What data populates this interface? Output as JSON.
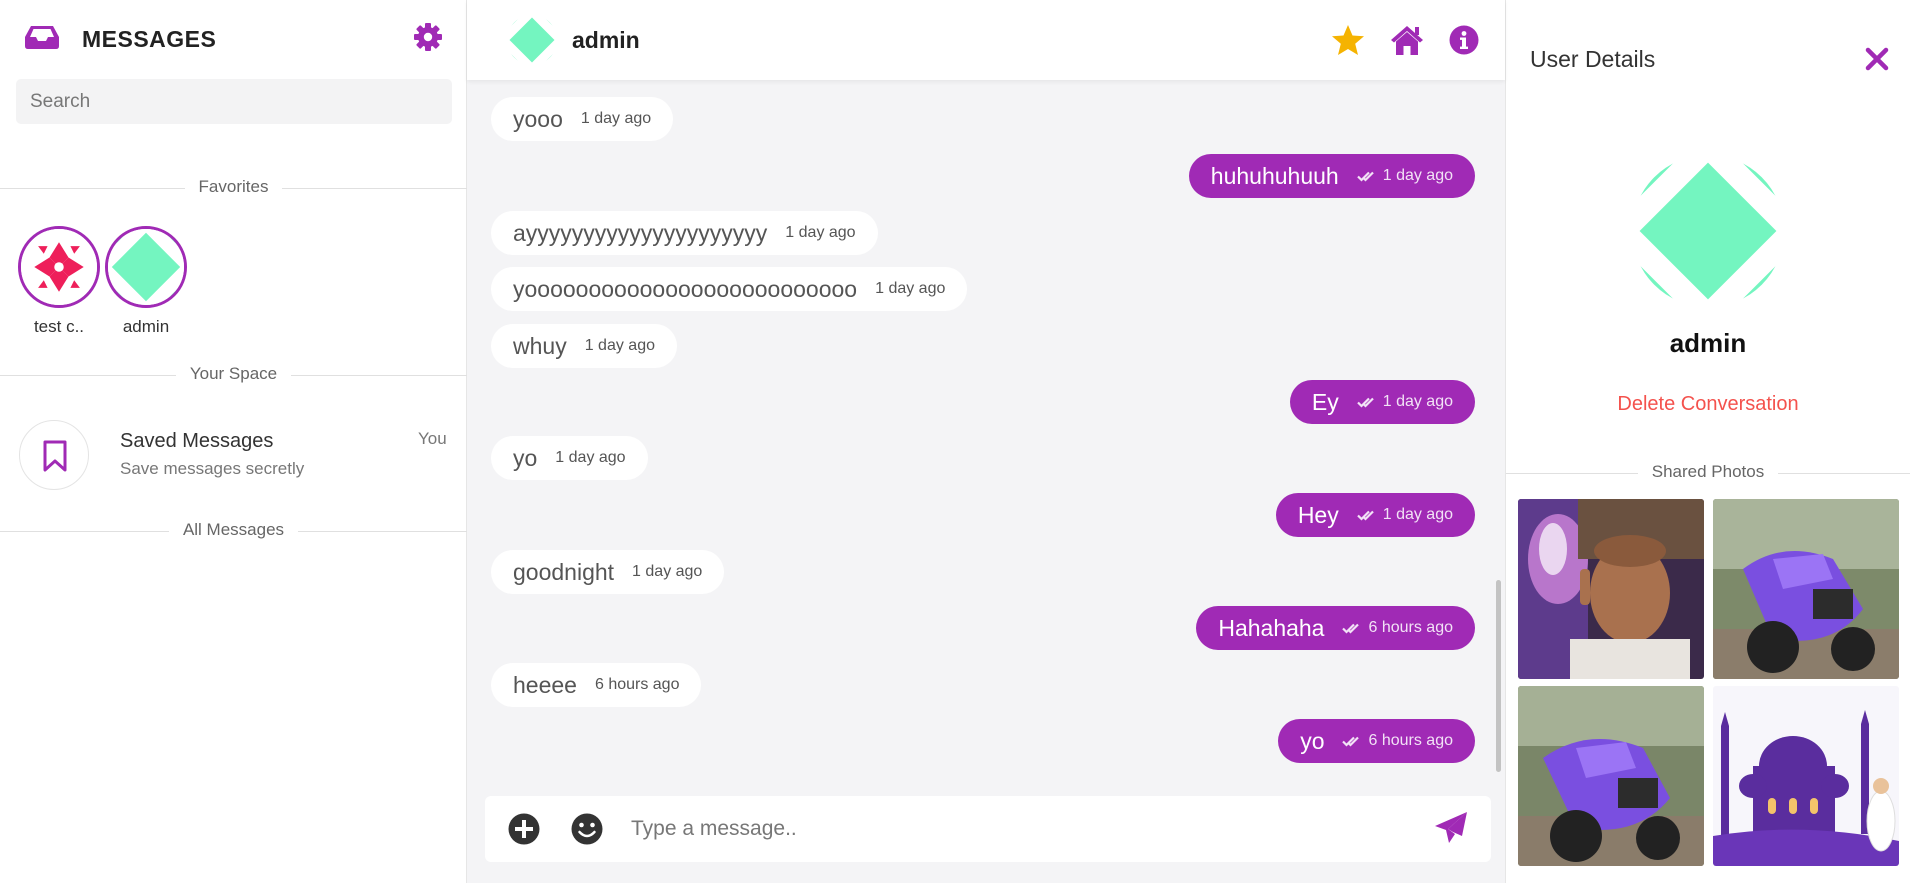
{
  "colors": {
    "accent": "#a02ab5",
    "favorite_star": "#f5b301",
    "delete": "#f4524d",
    "avatar_mint": "#74f5c0",
    "avatar_red": "#ee1f5a"
  },
  "sidebar": {
    "title": "MESSAGES",
    "icons": {
      "brand": "inbox-icon",
      "settings": "gear-icon"
    },
    "search": {
      "placeholder": "Search",
      "value": ""
    },
    "sections": {
      "favorites": "Favorites",
      "your_space": "Your Space",
      "all_messages": "All Messages"
    },
    "favorites": [
      {
        "name": "test c..",
        "avatar": "red-pattern"
      },
      {
        "name": "admin",
        "avatar": "mint-diamond"
      }
    ],
    "saved": {
      "title": "Saved Messages",
      "subtitle": "Save messages secretly",
      "tag": "You",
      "icon": "bookmark-icon"
    }
  },
  "chat": {
    "contact_name": "admin",
    "header_icons": [
      "star-icon",
      "home-icon",
      "info-icon"
    ],
    "messages": [
      {
        "direction": "in",
        "text": "yooo",
        "time": "1 day ago"
      },
      {
        "direction": "out",
        "text": "huhuhuhuuh",
        "time": "1 day ago"
      },
      {
        "direction": "in",
        "text": "ayyyyyyyyyyyyyyyyyyyyy",
        "time": "1 day ago"
      },
      {
        "direction": "in",
        "text": "yoooooooooooooooooooooooooo",
        "time": "1 day ago"
      },
      {
        "direction": "in",
        "text": "whuy",
        "time": "1 day ago"
      },
      {
        "direction": "out",
        "text": "Ey",
        "time": "1 day ago"
      },
      {
        "direction": "in",
        "text": "yo",
        "time": "1 day ago"
      },
      {
        "direction": "out",
        "text": "Hey",
        "time": "1 day ago"
      },
      {
        "direction": "in",
        "text": "goodnight",
        "time": "1 day ago"
      },
      {
        "direction": "out",
        "text": "Hahahaha",
        "time": "6 hours ago"
      },
      {
        "direction": "in",
        "text": "heeee",
        "time": "6 hours ago"
      },
      {
        "direction": "out",
        "text": "yo",
        "time": "6 hours ago"
      }
    ],
    "composer": {
      "placeholder": "Type a message..",
      "value": "",
      "icons": [
        "plus-circle-icon",
        "emoji-icon",
        "send-icon"
      ]
    }
  },
  "details": {
    "title": "User Details",
    "name": "admin",
    "delete_label": "Delete Conversation",
    "shared_photos_label": "Shared Photos",
    "photos": [
      "selfie-photo",
      "purple-scooter-photo",
      "purple-scooter-photo",
      "mosque-illustration-photo"
    ]
  }
}
